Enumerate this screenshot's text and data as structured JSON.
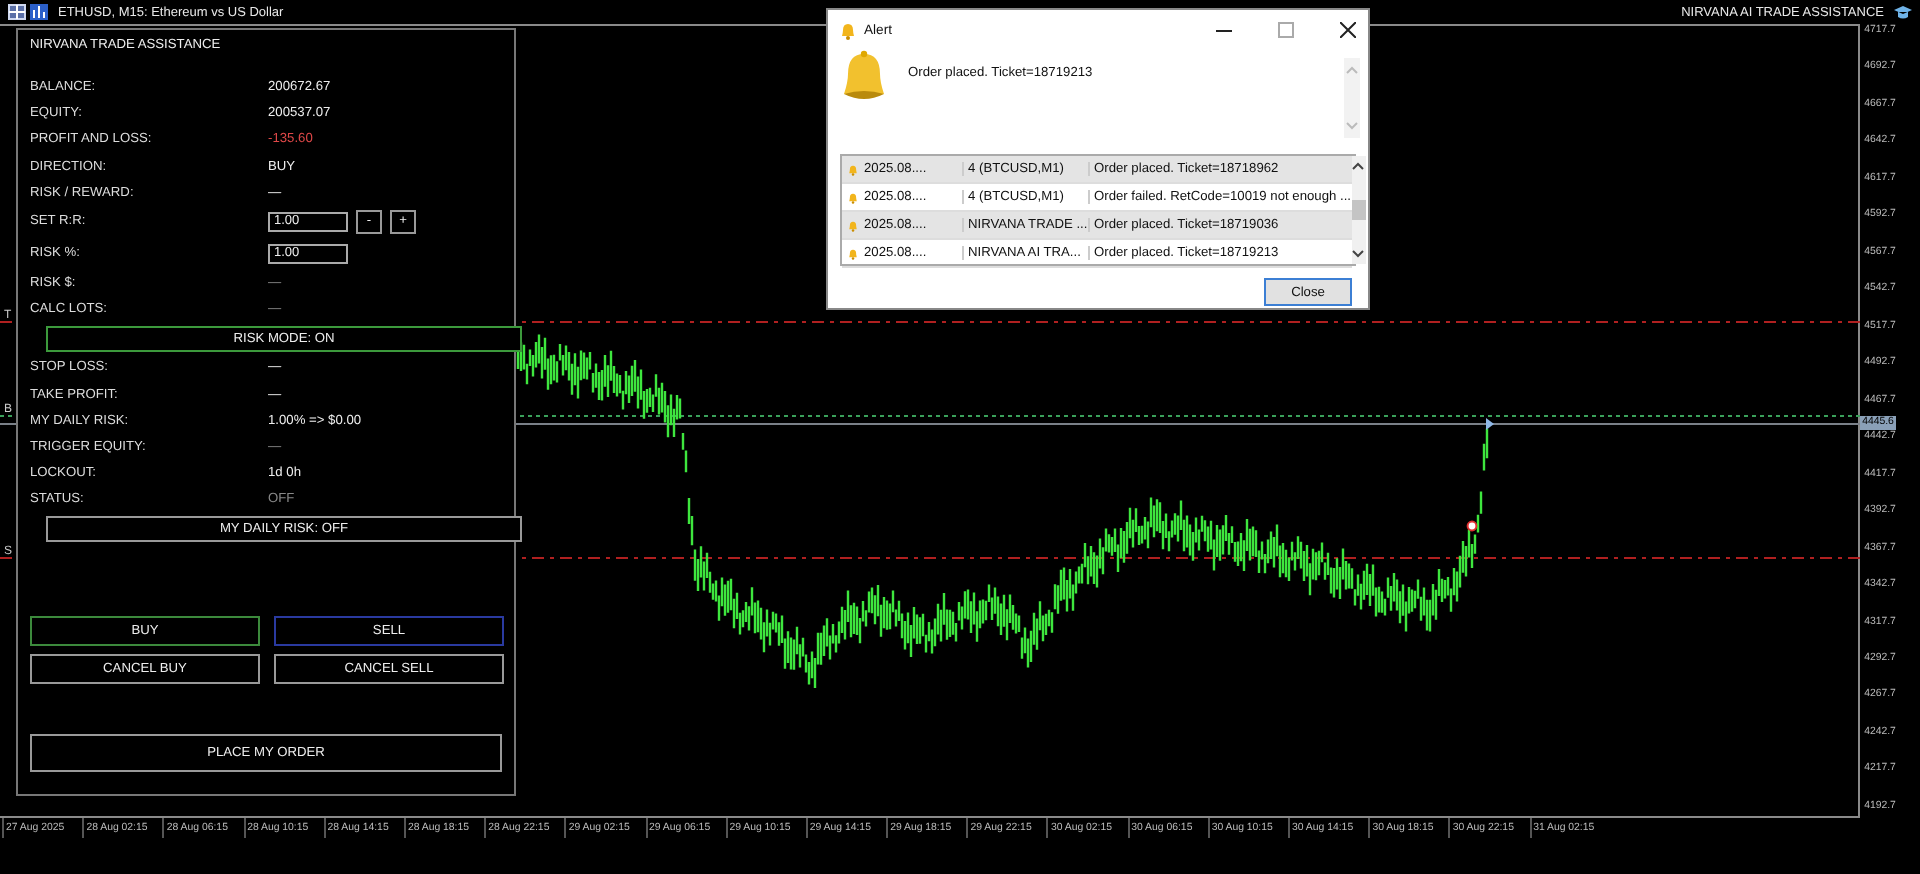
{
  "window": {
    "title": "ETHUSD, M15:  Ethereum vs US Dollar",
    "indicator_name": "NIRVANA AI TRADE ASSISTANCE"
  },
  "price_axis": {
    "labels": [
      "4717.7",
      "4692.7",
      "4667.7",
      "4642.7",
      "4617.7",
      "4592.7",
      "4567.7",
      "4542.7",
      "4517.7",
      "4492.7",
      "4467.7",
      "4442.7",
      "4417.7",
      "4392.7",
      "4367.7",
      "4342.7",
      "4317.7",
      "4292.7",
      "4267.7",
      "4242.7",
      "4217.7",
      "4192.7"
    ],
    "current_price": "4445.6"
  },
  "time_axis": {
    "labels": [
      "27 Aug 2025",
      "28 Aug 02:15",
      "28 Aug 06:15",
      "28 Aug 10:15",
      "28 Aug 14:15",
      "28 Aug 18:15",
      "28 Aug 22:15",
      "29 Aug 02:15",
      "29 Aug 06:15",
      "29 Aug 10:15",
      "29 Aug 14:15",
      "29 Aug 18:15",
      "29 Aug 22:15",
      "30 Aug 02:15",
      "30 Aug 06:15",
      "30 Aug 10:15",
      "30 Aug 14:15",
      "30 Aug 18:15",
      "30 Aug 22:15",
      "31 Aug 02:15"
    ]
  },
  "level_lines": [
    {
      "kind": "take_profit",
      "label": "T"
    },
    {
      "kind": "entry",
      "label": "B"
    },
    {
      "kind": "stop_loss",
      "label": "S"
    }
  ],
  "panel": {
    "title": "NIRVANA TRADE ASSISTANCE",
    "rows": [
      {
        "kind": "text",
        "label": "BALANCE:",
        "value": "200672.67",
        "negative": false,
        "dimmed": false
      },
      {
        "kind": "text",
        "label": "EQUITY:",
        "value": "200537.07",
        "negative": false,
        "dimmed": false
      },
      {
        "kind": "text",
        "label": "PROFIT AND LOSS:",
        "value": "-135.60",
        "negative": true,
        "dimmed": false
      },
      {
        "kind": "text",
        "label": "DIRECTION:",
        "value": "BUY",
        "negative": false,
        "dimmed": false
      },
      {
        "kind": "text",
        "label": "RISK / REWARD:",
        "value": "—",
        "negative": false,
        "dimmed": false
      },
      {
        "kind": "stepper",
        "label": "SET R:R:",
        "value": "1.00",
        "minus": "-",
        "plus": "+"
      },
      {
        "kind": "input",
        "label": "RISK %:",
        "value": "1.00"
      },
      {
        "kind": "text",
        "label": "RISK $:",
        "value": "—",
        "negative": false,
        "dimmed": true
      },
      {
        "kind": "text",
        "label": "CALC LOTS:",
        "value": "—",
        "negative": false,
        "dimmed": true
      },
      {
        "kind": "toggle",
        "button_text": "RISK MODE: ON",
        "on": true
      },
      {
        "kind": "text",
        "label": "STOP LOSS:",
        "value": "—",
        "negative": false,
        "dimmed": false
      },
      {
        "kind": "text",
        "label": "TAKE PROFIT:",
        "value": "—",
        "negative": false,
        "dimmed": false
      },
      {
        "kind": "text",
        "label": "MY DAILY RISK:",
        "value": "1.00%  =>  $0.00",
        "negative": false,
        "dimmed": false
      },
      {
        "kind": "text",
        "label": "TRIGGER EQUITY:",
        "value": "—",
        "negative": false,
        "dimmed": true
      },
      {
        "kind": "text",
        "label": "LOCKOUT:",
        "value": "1d 0h",
        "negative": false,
        "dimmed": false
      },
      {
        "kind": "text",
        "label": "STATUS:",
        "value": "OFF",
        "negative": false,
        "dimmed": true
      },
      {
        "kind": "toggle",
        "button_text": "MY DAILY RISK: OFF",
        "on": false
      }
    ],
    "order_buttons": [
      {
        "kind": "buy",
        "label": "BUY"
      },
      {
        "kind": "sell",
        "label": "SELL"
      },
      {
        "kind": "plain",
        "label": "CANCEL BUY"
      },
      {
        "kind": "plain",
        "label": "CANCEL SELL"
      }
    ],
    "place_button": "PLACE MY ORDER"
  },
  "alert": {
    "title": "Alert",
    "message": "Order placed. Ticket=18719213",
    "rows": [
      {
        "time": "2025.08....",
        "source": "4 (BTCUSD,M1)",
        "message": "Order placed. Ticket=18718962"
      },
      {
        "time": "2025.08....",
        "source": "4 (BTCUSD,M1)",
        "message": "Order failed. RetCode=10019  not enough ..."
      },
      {
        "time": "2025.08....",
        "source": "NIRVANA TRADE ...",
        "message": "Order placed. Ticket=18719036"
      },
      {
        "time": "2025.08....",
        "source": "NIRVANA AI TRA...",
        "message": "Order placed. Ticket=18719213"
      }
    ],
    "close_button": "Close"
  }
}
